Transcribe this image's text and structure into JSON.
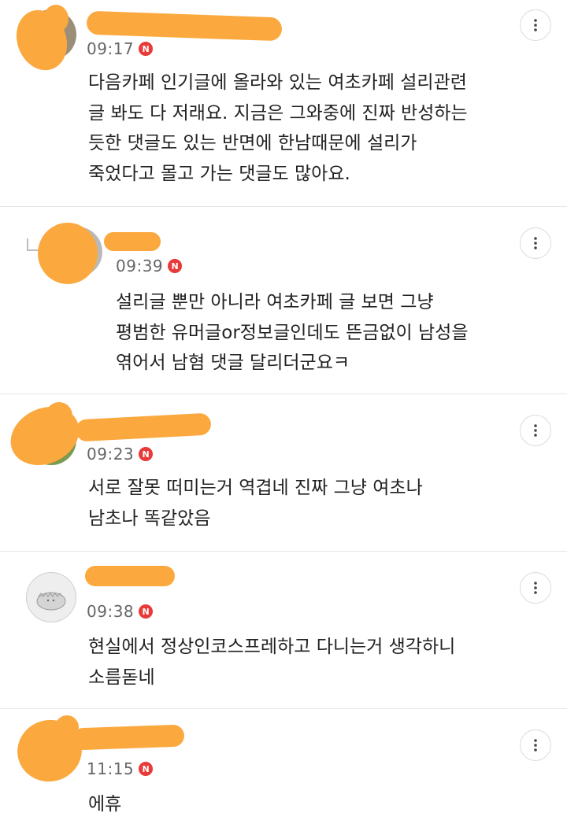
{
  "icons": {
    "more": "more-vertical-icon",
    "reply": "reply-arrow-icon",
    "new": "new-badge-icon"
  },
  "colors": {
    "redaction": "#fba93e",
    "badge": "#e93a3a",
    "divider": "#e6e6e6"
  },
  "comments": [
    {
      "time": "09:17",
      "badge": "N",
      "text": "다음카페 인기글에 올라와 있는 여초카페 설리관련\n글 봐도 다 저래요. 지금은 그와중에 진짜 반성하는\n듯한 댓글도 있는 반면에 한남때문에 설리가\n죽었다고 몰고 가는 댓글도 많아요."
    },
    {
      "time": "09:39",
      "badge": "N",
      "text": "설리글 뿐만 아니라 여초카페 글 보면 그냥\n평범한 유머글or정보글인데도 뜬금없이 남성을\n엮어서 남혐 댓글 달리더군요ㅋ"
    },
    {
      "time": "09:23",
      "badge": "N",
      "text": "서로 잘못 떠미는거 역겹네 진짜 그냥 여초나\n남초나 똑같았음"
    },
    {
      "time": "09:38",
      "badge": "N",
      "text": "현실에서 정상인코스프레하고 다니는거 생각하니\n소름돋네"
    },
    {
      "time": "11:15",
      "badge": "N",
      "text": "에휴"
    }
  ]
}
